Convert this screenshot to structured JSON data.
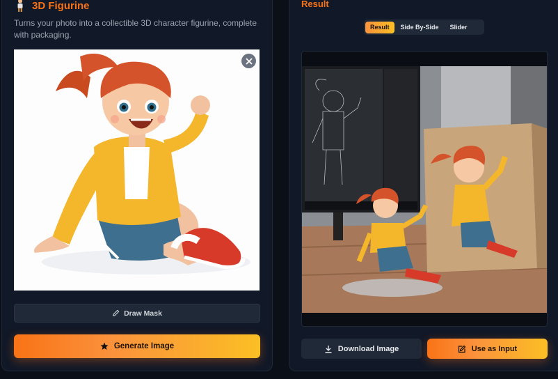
{
  "left": {
    "title": "3D Figurine",
    "description": "Turns your photo into a collectible 3D character figurine, complete with packaging.",
    "draw_mask_label": "Draw Mask",
    "generate_label": "Generate Image"
  },
  "right": {
    "title": "Result",
    "view_tabs": [
      "Result",
      "Side By-Side",
      "Slider"
    ],
    "active_tab": "Result",
    "download_label": "Download Image",
    "use_as_input_label": "Use as Input"
  },
  "colors": {
    "accent": "#f97316",
    "accent_gradient_end": "#fbbf24",
    "panel": "#111827",
    "background": "#0b0f17"
  },
  "icons": {
    "title_icon": "figurine-icon",
    "close": "close-icon",
    "mask": "pencil-icon",
    "generate": "star-icon",
    "download": "download-icon",
    "use_input": "edit-icon"
  }
}
